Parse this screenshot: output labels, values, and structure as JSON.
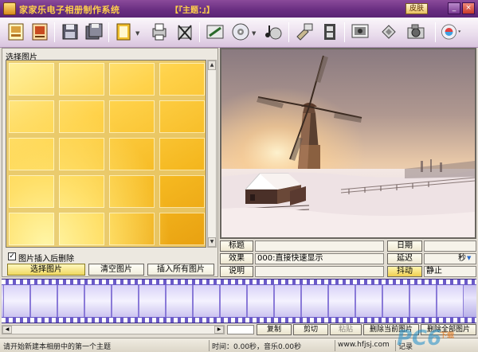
{
  "titlebar": {
    "title": "家家乐电子相册制作系统",
    "theme": "【『主题：』】",
    "skin_label": "皮肤",
    "minimize": "_",
    "close": "×"
  },
  "toolbar": {
    "icons": [
      "new-album-icon",
      "open-album-icon",
      "save-icon",
      "save-as-icon",
      "export-icon",
      "dropdown-icon",
      "print-icon",
      "delete-icon",
      "edit-pen-icon",
      "disc-icon",
      "music-icon",
      "tools-icon",
      "film-icon",
      "screen-icon",
      "paint-bucket-icon",
      "camera-icon",
      "options-icon"
    ]
  },
  "left_panel": {
    "label": "选择图片",
    "checkbox_label": "图片插入后删除",
    "checkbox_mark": "✓",
    "buttons": {
      "select": "选择图片",
      "clear": "清空图片",
      "insert_all": "插入所有图片"
    }
  },
  "info": {
    "title_label": "标题",
    "title_value": "",
    "date_label": "日期",
    "date_value": "",
    "effect_label": "效果",
    "effect_value": "000:直接快速显示",
    "delay_label": "延迟",
    "delay_unit": "秒",
    "delay_value": "",
    "desc_label": "说明",
    "desc_value": "",
    "shake_label": "抖动",
    "shake_value": "静止"
  },
  "bottom_buttons": {
    "copy": "复制",
    "cut": "剪切",
    "paste": "粘贴",
    "delete_current": "删除当前图片",
    "delete_all": "删除全部图片"
  },
  "status": {
    "message": "请开始新建本相册中的第一个主题",
    "time_info": "时间：0.00秒，音乐0.00秒",
    "site": "www.hfjsj.com",
    "extra": "记录"
  },
  "watermark": {
    "logo": "PC6",
    "sub": "下载"
  },
  "colors": {
    "title_bg": "#6a2f82",
    "title_text": "#ffd04a",
    "film": "#6a5ac8"
  }
}
